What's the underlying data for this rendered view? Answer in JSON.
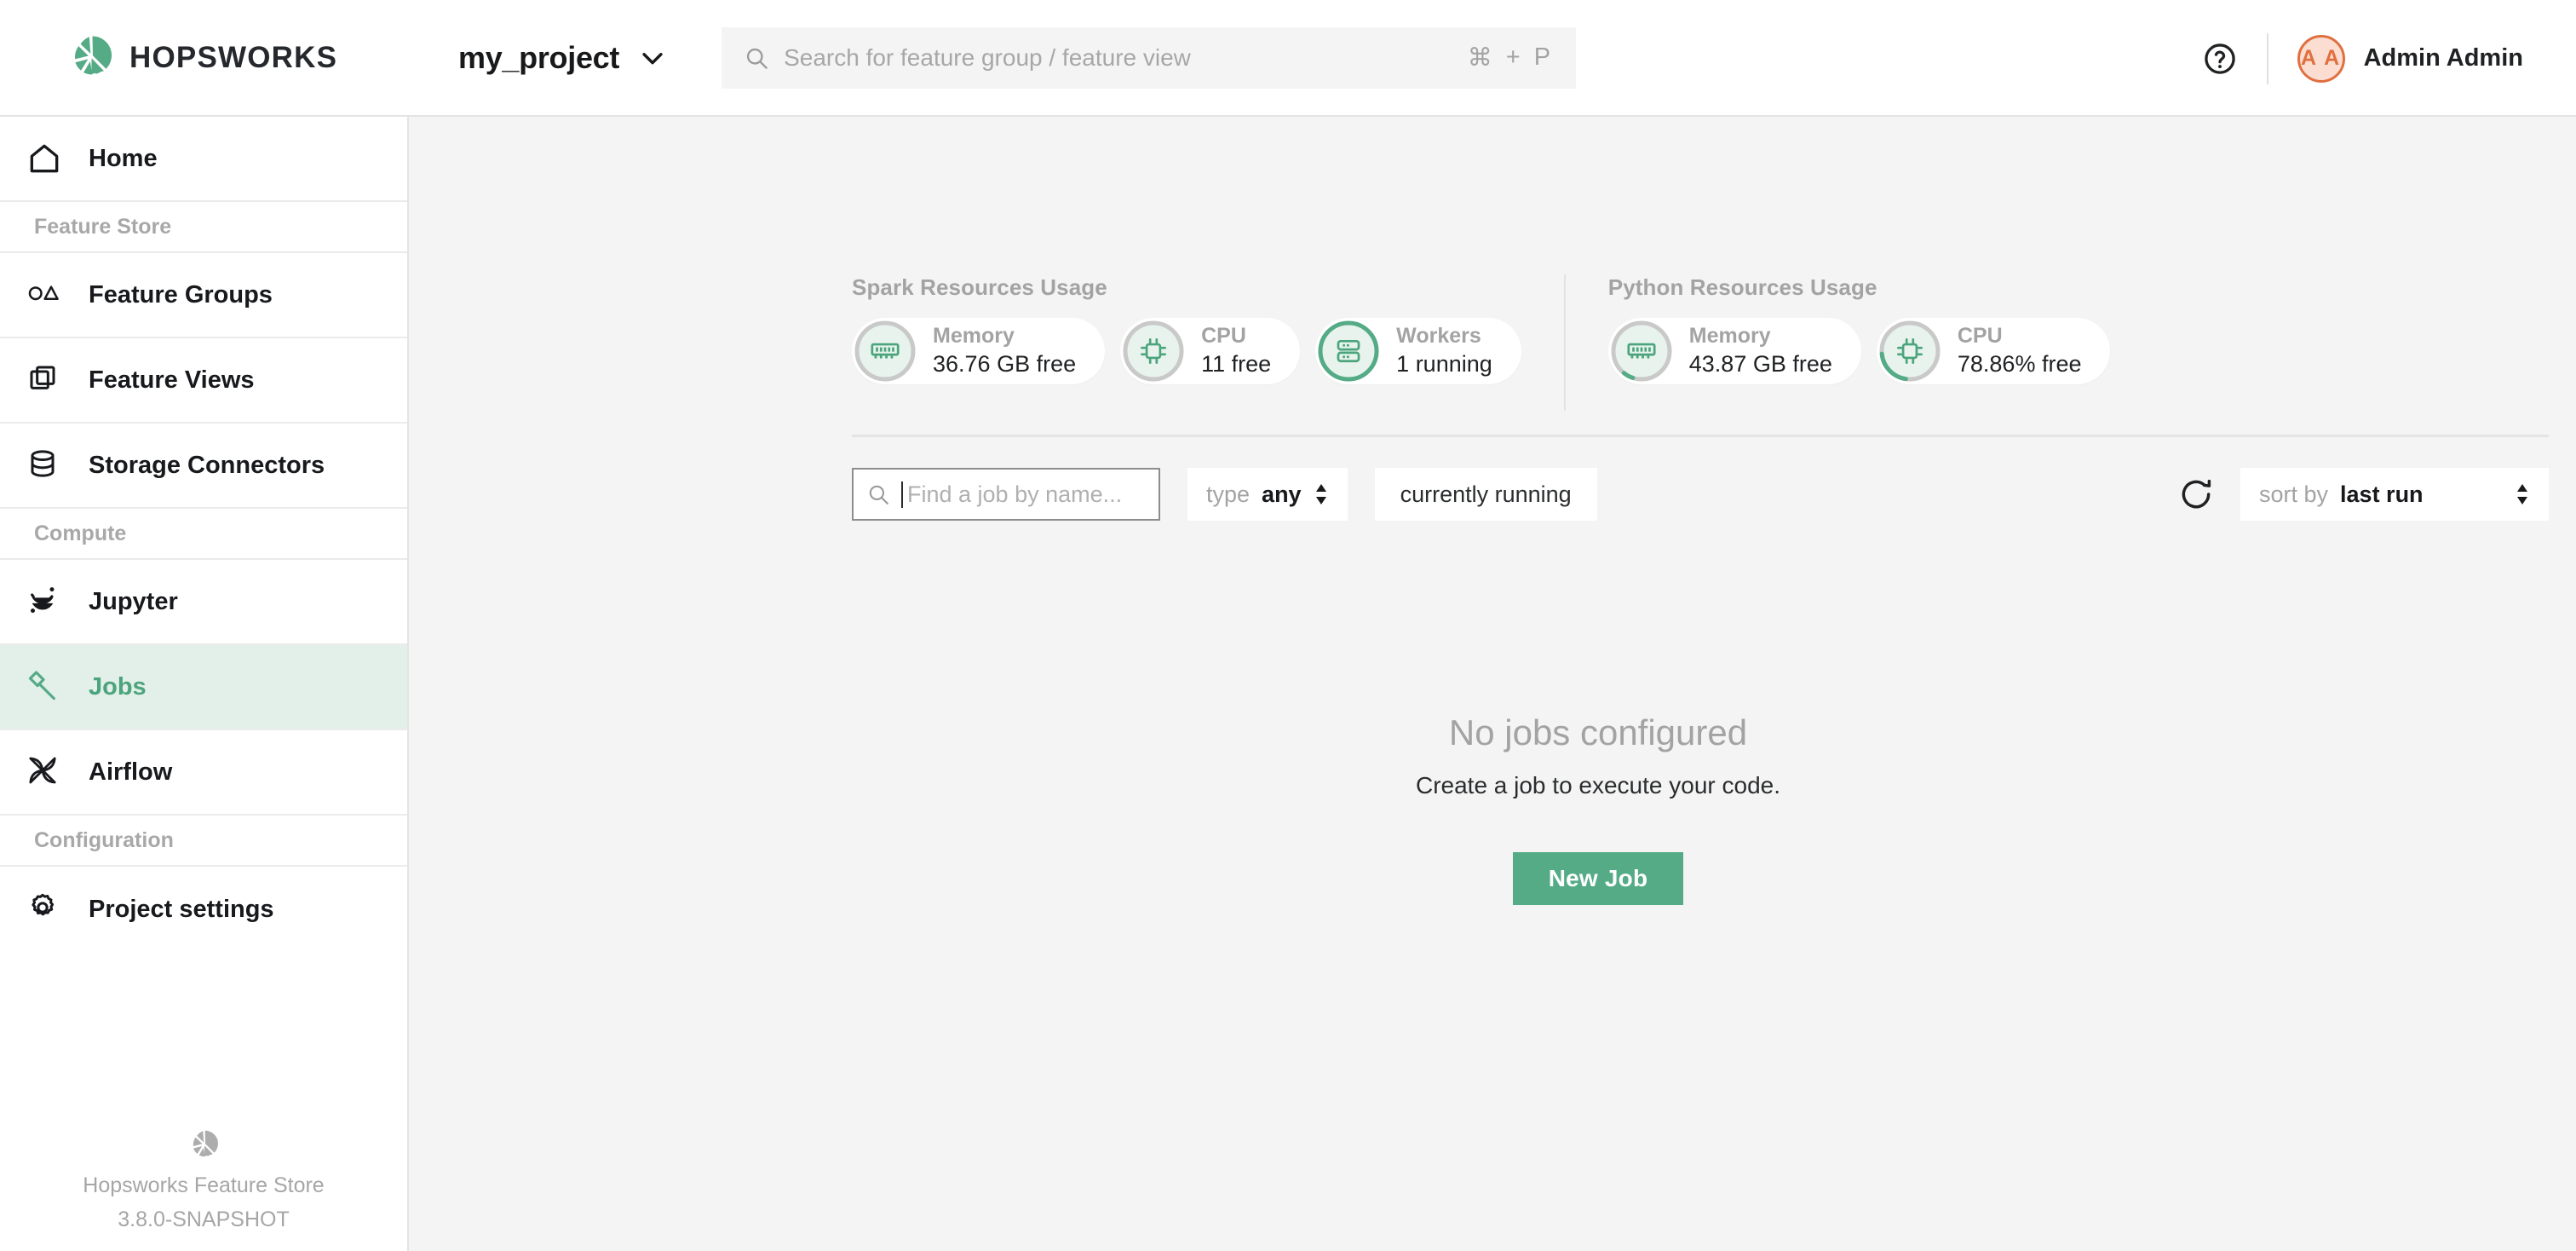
{
  "brand": {
    "name": "HOPSWORKS",
    "logo_icon": "hop-cone-logo-icon",
    "accent_color": "#54ab86"
  },
  "header": {
    "project_name": "my_project",
    "project_chevron_icon": "chevron-down-icon",
    "search": {
      "icon": "search-icon",
      "value": "",
      "placeholder": "Search for feature group / feature view",
      "shortcut_keys": [
        "⌘",
        "+",
        "P"
      ]
    },
    "help_icon": "question-mark-circle-icon",
    "user": {
      "avatar_initials": "A A",
      "avatar_text_color": "#e0703f",
      "avatar_bg_color": "#fbddd2",
      "name": "Admin Admin"
    }
  },
  "sidebar": {
    "items": [
      {
        "label": "Home",
        "icon": "house-icon",
        "active": false
      },
      {
        "label": "Feature Groups",
        "icon": "circle-triangle-icon",
        "active": false
      },
      {
        "label": "Feature Views",
        "icon": "overlapping-squares-icon",
        "active": false
      },
      {
        "label": "Storage Connectors",
        "icon": "database-cylinder-icon",
        "active": false
      },
      {
        "label": "Jupyter",
        "icon": "jupyter-planet-icon",
        "active": false
      },
      {
        "label": "Jobs",
        "icon": "hammer-icon",
        "active": true
      },
      {
        "label": "Airflow",
        "icon": "pinwheel-icon",
        "active": false
      },
      {
        "label": "Project settings",
        "icon": "gear-icon",
        "active": false
      }
    ],
    "sections": {
      "feature_store": "Feature Store",
      "compute": "Compute",
      "configuration": "Configuration"
    },
    "footer": {
      "logo_icon": "hop-cone-logo-gray-icon",
      "product": "Hopsworks Feature Store",
      "version": "3.8.0-SNAPSHOT"
    }
  },
  "resources": {
    "spark": {
      "title": "Spark Resources Usage",
      "cards": [
        {
          "label": "Memory",
          "value": "36.76 GB free",
          "icon": "ram-stick-icon",
          "ring_pct": 0
        },
        {
          "label": "CPU",
          "value": "11 free",
          "icon": "cpu-chip-icon",
          "ring_pct": 0
        },
        {
          "label": "Workers",
          "value": "1 running",
          "icon": "server-stack-icon",
          "ring_pct": 100
        }
      ]
    },
    "python": {
      "title": "Python Resources Usage",
      "cards": [
        {
          "label": "Memory",
          "value": "43.87 GB free",
          "icon": "ram-stick-icon",
          "ring_pct": 6
        },
        {
          "label": "CPU",
          "value": "78.86% free",
          "icon": "cpu-chip-icon",
          "ring_pct": 21
        }
      ]
    }
  },
  "toolbar": {
    "job_search": {
      "icon": "search-icon",
      "value": "",
      "placeholder": "Find a job by name..."
    },
    "type_filter": {
      "key": "type",
      "value": "any",
      "icon": "up-down-arrows-icon"
    },
    "running_chip": "currently running",
    "refresh_icon": "refresh-icon",
    "sort": {
      "key": "sort by",
      "value": "last run",
      "icon": "up-down-arrows-icon"
    }
  },
  "empty_state": {
    "title": "No jobs configured",
    "subtitle": "Create a job to execute your code.",
    "cta_label": "New Job"
  }
}
